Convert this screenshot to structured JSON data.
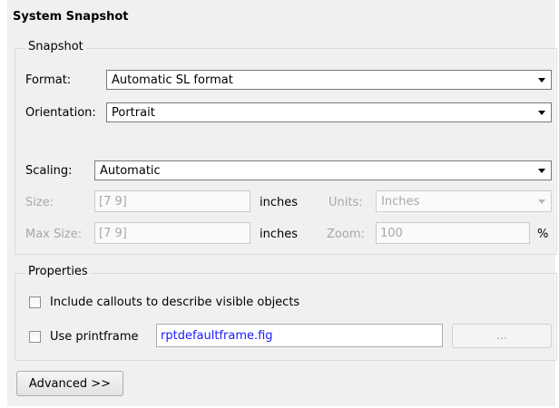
{
  "title": "System Snapshot",
  "snapshot": {
    "group_label": "Snapshot",
    "format_label": "Format:",
    "format_value": "Automatic SL format",
    "orientation_label": "Orientation:",
    "orientation_value": "Portrait",
    "scaling_label": "Scaling:",
    "scaling_value": "Automatic",
    "size_label": "Size:",
    "size_value": "[7 9]",
    "size_unit": "inches",
    "units_label": "Units:",
    "units_value": "Inches",
    "maxsize_label": "Max Size:",
    "maxsize_value": "[7 9]",
    "maxsize_unit": "inches",
    "zoom_label": "Zoom:",
    "zoom_value": "100",
    "zoom_unit": "%"
  },
  "properties": {
    "group_label": "Properties",
    "callouts_label": "Include callouts to describe visible objects",
    "callouts_checked": false,
    "printframe_label": "Use printframe",
    "printframe_checked": false,
    "printframe_value": "rptdefaultframe.fig",
    "browse_label": "..."
  },
  "advanced_label": "Advanced >>",
  "colors": {
    "panel_bg": "#f0f0f0",
    "link_text": "#1a1aff",
    "disabled_text": "#a8a8a8"
  }
}
